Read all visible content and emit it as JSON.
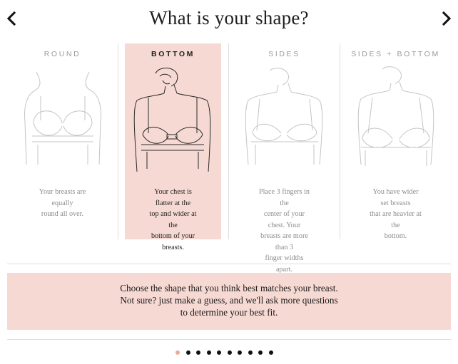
{
  "header": {
    "title": "What is your shape?",
    "prev_icon": "chevron-left-icon",
    "next_icon": "chevron-right-icon"
  },
  "shapes": [
    {
      "title": "ROUND",
      "description": [
        "Your breasts are equally",
        "round all over."
      ],
      "selected": false
    },
    {
      "title": "BOTTOM",
      "description": [
        "Your chest is flatter at the",
        "top and wider at the",
        "bottom of your breasts."
      ],
      "selected": true
    },
    {
      "title": "SIDES",
      "description": [
        "Place 3 fingers in the",
        "center of your chest. Your",
        "breasts are more than 3",
        "finger widths apart."
      ],
      "selected": false
    },
    {
      "title": "SIDES + BOTTOM",
      "description": [
        "You have wider set breasts",
        "that are heavier at the",
        "bottom."
      ],
      "selected": false
    }
  ],
  "instructions": [
    "Choose the shape that you think best matches your breast.",
    "Not sure? just make a guess, and we'll ask more questions",
    "to determine your best fit."
  ],
  "pager": {
    "total": 10,
    "current": 1
  },
  "colors": {
    "highlight": "#f6d9d2",
    "active_dot": "#e8ab97",
    "divider": "#dedede"
  }
}
